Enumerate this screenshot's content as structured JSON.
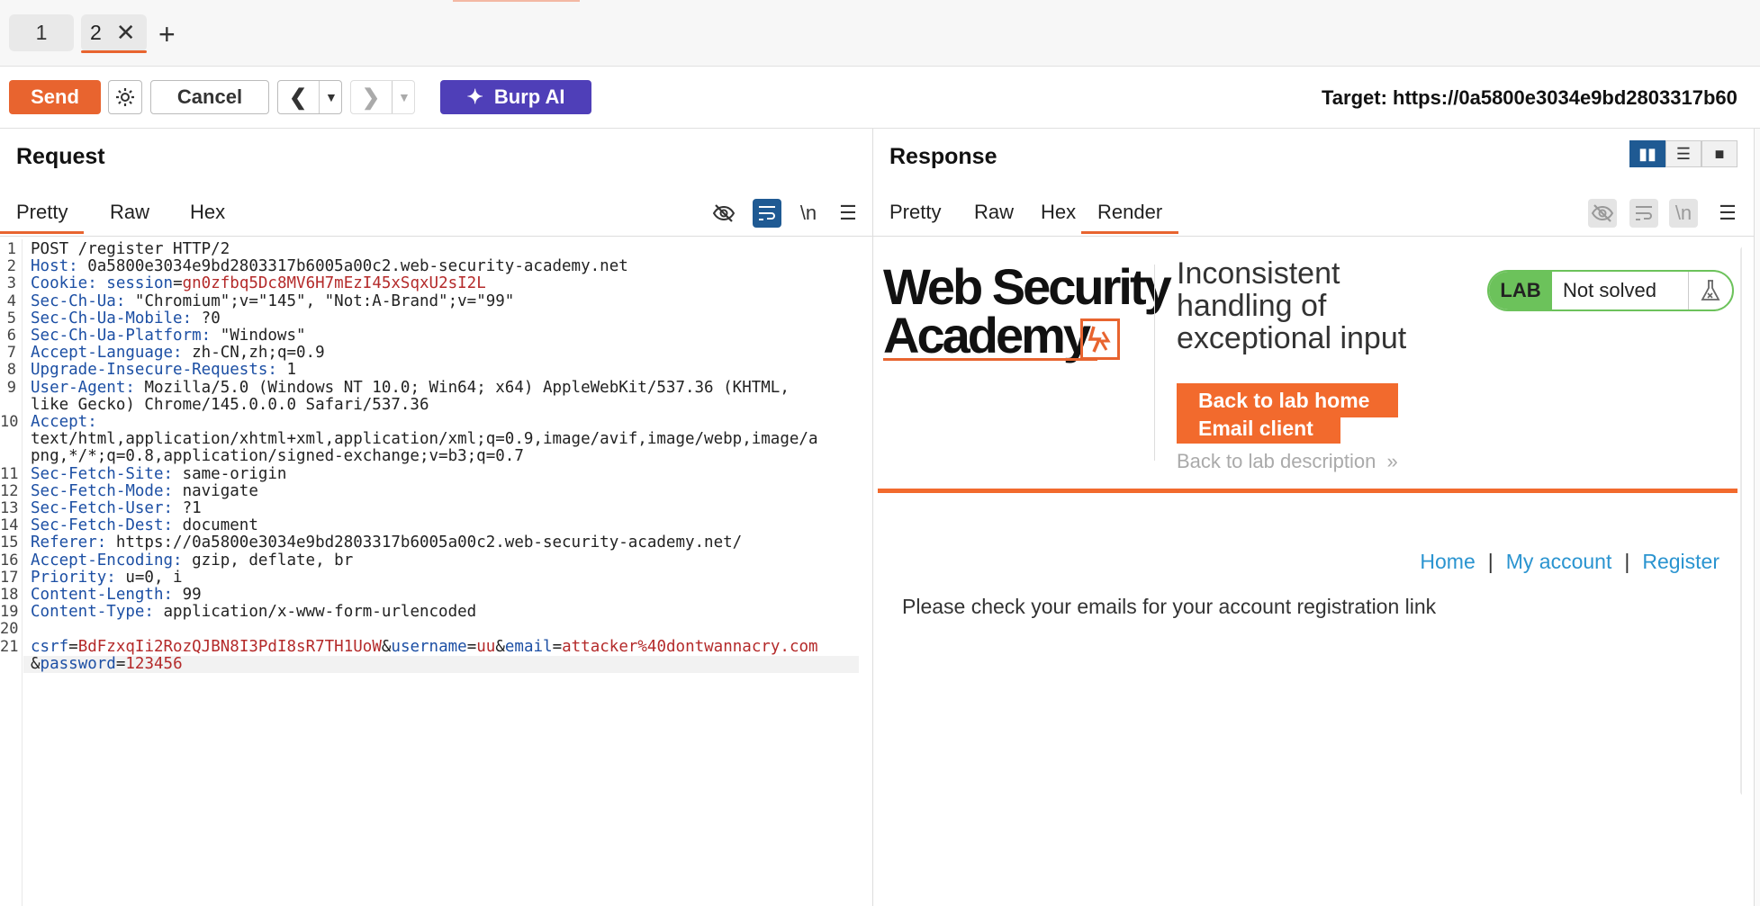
{
  "tabs": [
    {
      "label": "1"
    },
    {
      "label": "2"
    }
  ],
  "toolbar": {
    "send": "Send",
    "cancel": "Cancel",
    "burp_ai": "Burp AI",
    "target": "Target: https://0a5800e3034e9bd2803317b60"
  },
  "request": {
    "title": "Request",
    "tabs": [
      "Pretty",
      "Raw",
      "Hex"
    ],
    "newline_toggle": "\\n",
    "lines": [
      {
        "n": "1",
        "parts": [
          {
            "t": "POST /register HTTP/2",
            "c": ""
          }
        ]
      },
      {
        "n": "2",
        "parts": [
          {
            "t": "Host: ",
            "c": "k"
          },
          {
            "t": "0a5800e3034e9bd2803317b6005a00c2.web-security-academy.net",
            "c": ""
          }
        ]
      },
      {
        "n": "3",
        "parts": [
          {
            "t": "Cookie: ",
            "c": "k"
          },
          {
            "t": "session",
            "c": "k"
          },
          {
            "t": "=",
            "c": ""
          },
          {
            "t": "gn0zfbq5Dc8MV6H7mEzI45xSqxU2sI2L",
            "c": "v"
          }
        ]
      },
      {
        "n": "4",
        "parts": [
          {
            "t": "Sec-Ch-Ua: ",
            "c": "k"
          },
          {
            "t": "\"Chromium\";v=\"145\", \"Not:A-Brand\";v=\"99\"",
            "c": ""
          }
        ]
      },
      {
        "n": "5",
        "parts": [
          {
            "t": "Sec-Ch-Ua-Mobile: ",
            "c": "k"
          },
          {
            "t": "?0",
            "c": ""
          }
        ]
      },
      {
        "n": "6",
        "parts": [
          {
            "t": "Sec-Ch-Ua-Platform: ",
            "c": "k"
          },
          {
            "t": "\"Windows\"",
            "c": ""
          }
        ]
      },
      {
        "n": "7",
        "parts": [
          {
            "t": "Accept-Language: ",
            "c": "k"
          },
          {
            "t": "zh-CN,zh;q=0.9",
            "c": ""
          }
        ]
      },
      {
        "n": "8",
        "parts": [
          {
            "t": "Upgrade-Insecure-Requests: ",
            "c": "k"
          },
          {
            "t": "1",
            "c": ""
          }
        ]
      },
      {
        "n": "9",
        "parts": [
          {
            "t": "User-Agent: ",
            "c": "k"
          },
          {
            "t": "Mozilla/5.0 (Windows NT 10.0; Win64; x64) AppleWebKit/537.36 (KHTML,",
            "c": ""
          }
        ]
      },
      {
        "n": "",
        "parts": [
          {
            "t": "like Gecko) Chrome/145.0.0.0 Safari/537.36",
            "c": ""
          }
        ]
      },
      {
        "n": "10",
        "parts": [
          {
            "t": "Accept:",
            "c": "k"
          }
        ]
      },
      {
        "n": "",
        "parts": [
          {
            "t": "text/html,application/xhtml+xml,application/xml;q=0.9,image/avif,image/webp,image/a",
            "c": ""
          }
        ]
      },
      {
        "n": "",
        "parts": [
          {
            "t": "png,*/*;q=0.8,application/signed-exchange;v=b3;q=0.7",
            "c": ""
          }
        ]
      },
      {
        "n": "11",
        "parts": [
          {
            "t": "Sec-Fetch-Site: ",
            "c": "k"
          },
          {
            "t": "same-origin",
            "c": ""
          }
        ]
      },
      {
        "n": "12",
        "parts": [
          {
            "t": "Sec-Fetch-Mode: ",
            "c": "k"
          },
          {
            "t": "navigate",
            "c": ""
          }
        ]
      },
      {
        "n": "13",
        "parts": [
          {
            "t": "Sec-Fetch-User: ",
            "c": "k"
          },
          {
            "t": "?1",
            "c": ""
          }
        ]
      },
      {
        "n": "14",
        "parts": [
          {
            "t": "Sec-Fetch-Dest: ",
            "c": "k"
          },
          {
            "t": "document",
            "c": ""
          }
        ]
      },
      {
        "n": "15",
        "parts": [
          {
            "t": "Referer: ",
            "c": "k"
          },
          {
            "t": "https://0a5800e3034e9bd2803317b6005a00c2.web-security-academy.net/",
            "c": ""
          }
        ]
      },
      {
        "n": "16",
        "parts": [
          {
            "t": "Accept-Encoding: ",
            "c": "k"
          },
          {
            "t": "gzip, deflate, br",
            "c": ""
          }
        ]
      },
      {
        "n": "17",
        "parts": [
          {
            "t": "Priority: ",
            "c": "k"
          },
          {
            "t": "u=0, i",
            "c": ""
          }
        ]
      },
      {
        "n": "18",
        "parts": [
          {
            "t": "Content-Length: ",
            "c": "k"
          },
          {
            "t": "99",
            "c": ""
          }
        ]
      },
      {
        "n": "19",
        "parts": [
          {
            "t": "Content-Type: ",
            "c": "k"
          },
          {
            "t": "application/x-www-form-urlencoded",
            "c": ""
          }
        ]
      },
      {
        "n": "20",
        "parts": []
      },
      {
        "n": "21",
        "parts": [
          {
            "t": "csrf",
            "c": "k"
          },
          {
            "t": "=",
            "c": ""
          },
          {
            "t": "BdFzxqIi2RozQJBN8I3PdI8sR7TH1UoW",
            "c": "v"
          },
          {
            "t": "&",
            "c": ""
          },
          {
            "t": "username",
            "c": "k"
          },
          {
            "t": "=",
            "c": ""
          },
          {
            "t": "uu",
            "c": "v"
          },
          {
            "t": "&",
            "c": ""
          },
          {
            "t": "email",
            "c": "k"
          },
          {
            "t": "=",
            "c": ""
          },
          {
            "t": "attacker%40dontwannacry.com",
            "c": "v"
          }
        ]
      },
      {
        "n": "",
        "parts": [
          {
            "t": "&",
            "c": ""
          },
          {
            "t": "password",
            "c": "k"
          },
          {
            "t": "=",
            "c": ""
          },
          {
            "t": "123456",
            "c": "v"
          }
        ],
        "highlight": true
      }
    ]
  },
  "response": {
    "title": "Response",
    "tabs": [
      "Pretty",
      "Raw",
      "Hex",
      "Render"
    ],
    "newline_toggle": "\\n",
    "render": {
      "logo_line1": "Web Security",
      "logo_line2": "Academy",
      "lab_title": "Inconsistent handling of exceptional input",
      "back_home": "Back to lab home",
      "email_client": "Email client",
      "back_desc": "Back to lab description",
      "lab_badge": "LAB",
      "lab_status": "Not solved",
      "nav_home": "Home",
      "nav_account": "My account",
      "nav_register": "Register",
      "nav_sep": "|",
      "message": "Please check your emails for your account registration link"
    }
  },
  "colors": {
    "accent": "#e8642f",
    "ai": "#4f3fb8",
    "active_icon": "#1f5a93",
    "lab_green": "#6cc25b",
    "link": "#2a94d0"
  }
}
